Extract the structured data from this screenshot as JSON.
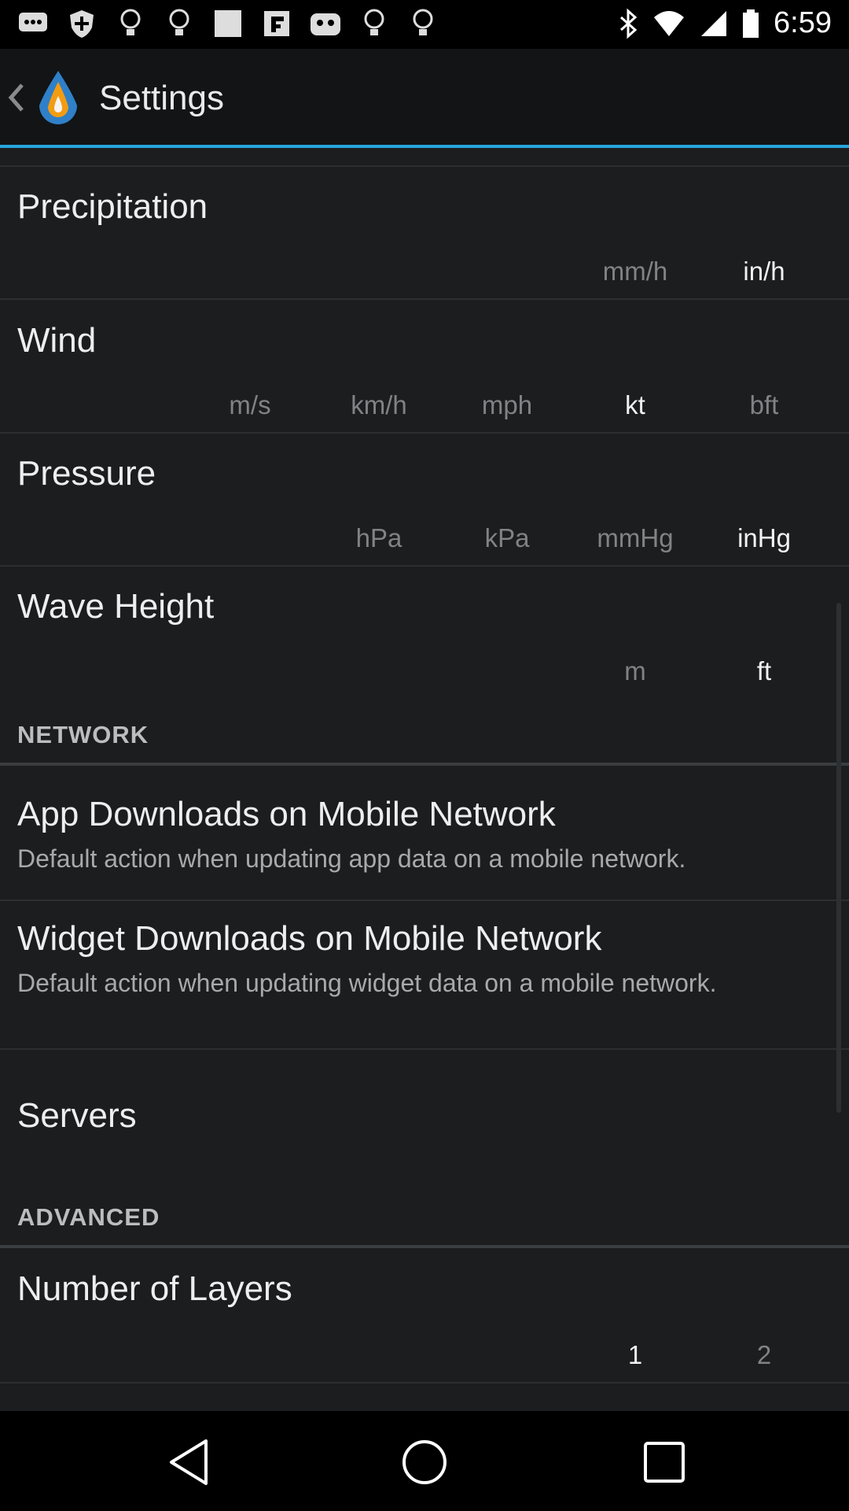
{
  "status_bar": {
    "time": "6:59",
    "left_icons": [
      "message-icon",
      "shield-icon",
      "bulb-icon",
      "bulb-icon",
      "image-icon",
      "flipboard-icon",
      "game-icon",
      "bulb-icon",
      "bulb-icon"
    ],
    "right_icons": [
      "bluetooth-icon",
      "wifi-icon",
      "signal-icon",
      "battery-icon"
    ]
  },
  "app_bar": {
    "title": "Settings",
    "accent_color": "#27a6de"
  },
  "units": [
    {
      "label": "Precipitation",
      "options": [
        "mm/h",
        "in/h"
      ],
      "selected": "in/h"
    },
    {
      "label": "Wind",
      "options": [
        "m/s",
        "km/h",
        "mph",
        "kt",
        "bft"
      ],
      "selected": "kt"
    },
    {
      "label": "Pressure",
      "options": [
        "hPa",
        "kPa",
        "mmHg",
        "inHg"
      ],
      "selected": "inHg"
    },
    {
      "label": "Wave Height",
      "options": [
        "m",
        "ft"
      ],
      "selected": "ft"
    }
  ],
  "network": {
    "header": "NETWORK",
    "items": [
      {
        "title": "App Downloads on Mobile Network",
        "subtitle": "Default action when updating app data on a mobile network."
      },
      {
        "title": "Widget Downloads on Mobile Network",
        "subtitle": "Default action when updating widget data on a mobile network."
      },
      {
        "title": "Servers"
      }
    ]
  },
  "advanced": {
    "header": "ADVANCED",
    "layers": {
      "label": "Number of Layers",
      "options": [
        "1",
        "2"
      ],
      "selected": "1"
    }
  }
}
